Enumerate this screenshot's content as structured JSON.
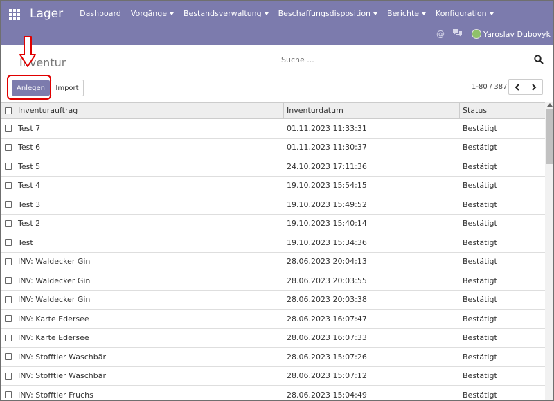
{
  "app": {
    "title": "Lager"
  },
  "nav": [
    {
      "label": "Dashboard",
      "dropdown": false
    },
    {
      "label": "Vorgänge",
      "dropdown": true
    },
    {
      "label": "Bestandsverwaltung",
      "dropdown": true
    },
    {
      "label": "Beschaffungsdisposition",
      "dropdown": true
    },
    {
      "label": "Berichte",
      "dropdown": true
    },
    {
      "label": "Konfiguration",
      "dropdown": true
    }
  ],
  "user": {
    "name": "Yaroslav Dubovyk"
  },
  "page": {
    "title": "Inventur"
  },
  "search": {
    "placeholder": "Suche ..."
  },
  "buttons": {
    "create": "Anlegen",
    "import": "Import"
  },
  "pager": {
    "label": "1-80 / 387"
  },
  "table": {
    "headers": [
      "Inventurauftrag",
      "Inventurdatum",
      "Status"
    ],
    "rows": [
      [
        "Test 7",
        "01.11.2023 11:33:31",
        "Bestätigt"
      ],
      [
        "Test 6",
        "01.11.2023 11:30:37",
        "Bestätigt"
      ],
      [
        "Test 5",
        "24.10.2023 17:11:36",
        "Bestätigt"
      ],
      [
        "Test 4",
        "19.10.2023 15:54:15",
        "Bestätigt"
      ],
      [
        "Test 3",
        "19.10.2023 15:49:52",
        "Bestätigt"
      ],
      [
        "Test 2",
        "19.10.2023 15:40:14",
        "Bestätigt"
      ],
      [
        "Test",
        "19.10.2023 15:34:36",
        "Bestätigt"
      ],
      [
        "INV: Waldecker Gin",
        "28.06.2023 20:04:13",
        "Bestätigt"
      ],
      [
        "INV: Waldecker Gin",
        "28.06.2023 20:03:55",
        "Bestätigt"
      ],
      [
        "INV: Waldecker Gin",
        "28.06.2023 20:03:38",
        "Bestätigt"
      ],
      [
        "INV: Karte Edersee",
        "28.06.2023 16:07:47",
        "Bestätigt"
      ],
      [
        "INV: Karte Edersee",
        "28.06.2023 16:07:33",
        "Bestätigt"
      ],
      [
        "INV: Stofftier Waschbär",
        "28.06.2023 15:07:26",
        "Bestätigt"
      ],
      [
        "INV: Stofftier Waschbär",
        "28.06.2023 15:07:12",
        "Bestätigt"
      ],
      [
        "INV: Stofftier Fruchs",
        "28.06.2023 15:04:49",
        "Bestätigt"
      ]
    ]
  },
  "colors": {
    "brand": "#7c7bad",
    "annotation": "#e00000"
  },
  "icons": {
    "apps": "grid-icon",
    "mention": "at-icon",
    "chat": "chat-icon",
    "search": "search-icon",
    "annotation_arrow": "down-arrow-icon"
  }
}
